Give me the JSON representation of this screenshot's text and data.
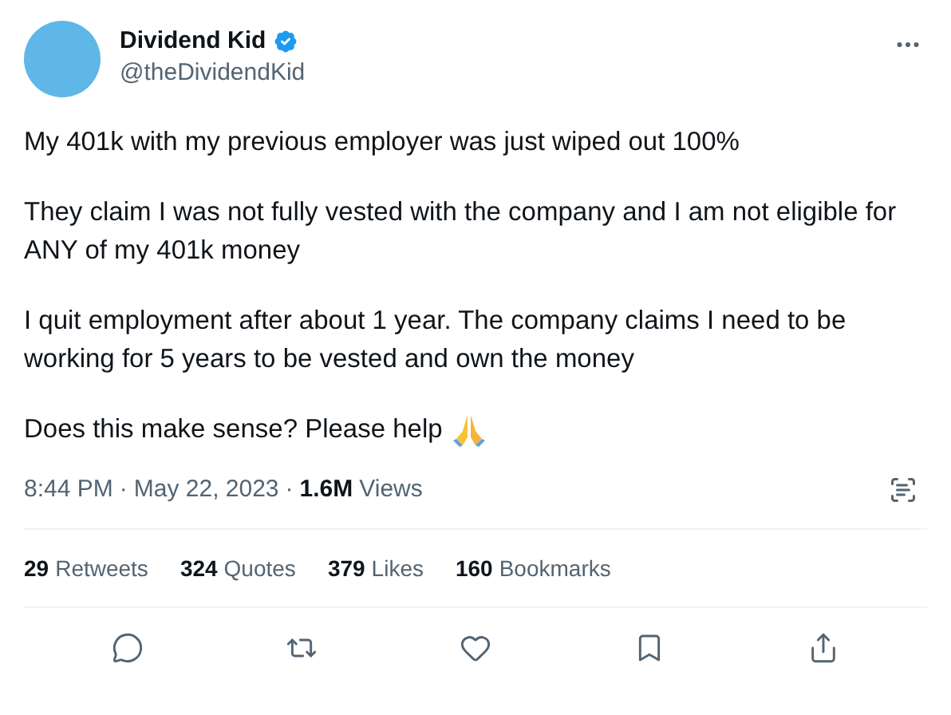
{
  "author": {
    "name": "Dividend Kid",
    "handle": "@theDividendKid",
    "verified": true
  },
  "paragraphs": [
    "My 401k with my previous employer was just wiped out 100%",
    "They claim I was not fully vested with the company and I am not eligible for ANY of my 401k money",
    "I quit employment after about 1 year. The company claims I need to be working for 5 years to be vested and own the money",
    "Does this make sense? Please help"
  ],
  "meta": {
    "time": "8:44 PM",
    "separator": "·",
    "date": "May 22, 2023",
    "views_count": "1.6M",
    "views_label": "Views"
  },
  "stats": [
    {
      "count": "29",
      "label": "Retweets"
    },
    {
      "count": "324",
      "label": "Quotes"
    },
    {
      "count": "379",
      "label": "Likes"
    },
    {
      "count": "160",
      "label": "Bookmarks"
    }
  ]
}
